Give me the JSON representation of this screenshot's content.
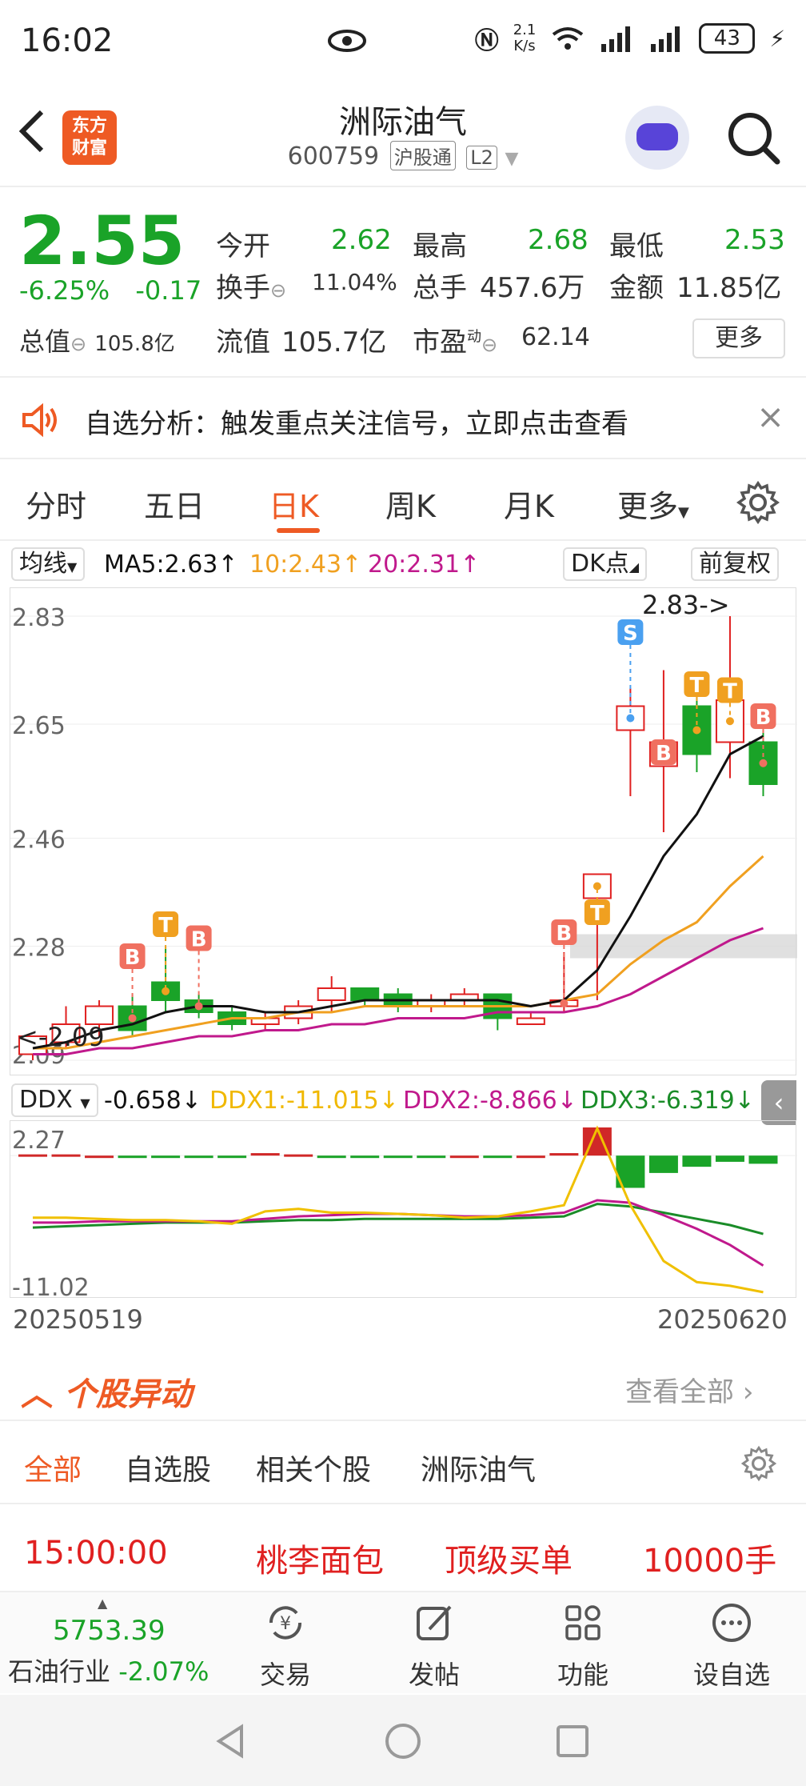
{
  "status_bar": {
    "time": "16:02",
    "net_speed_top": "2.1",
    "net_speed_bottom": "K/s",
    "battery": "43"
  },
  "header": {
    "back_icon": "chevron-left-icon",
    "logo_line1": "东方",
    "logo_line2": "财富",
    "stock_name": "洲际油气",
    "stock_code": "600759",
    "tag_hgt": "沪股通",
    "tag_l2": "L2"
  },
  "quote": {
    "price": "2.55",
    "change_pct": "-6.25%",
    "change_abs": "-0.17",
    "market_cap_label": "总值",
    "market_cap_value": "105.8亿",
    "open_label": "今开",
    "open_value": "2.62",
    "high_label": "最高",
    "high_value": "2.68",
    "low_label": "最低",
    "low_value": "2.53",
    "turnover_label": "换手",
    "turnover_value": "11.04%",
    "volume_label": "总手",
    "volume_value": "457.6万",
    "amount_label": "金额",
    "amount_value": "11.85亿",
    "float_label": "流值",
    "float_value": "105.7亿",
    "pe_label": "市盈",
    "pe_sup": "动",
    "pe_value": "62.14",
    "more_label": "更多"
  },
  "notice": {
    "text": "自选分析：触发重点关注信号，立即点击查看",
    "close": "×"
  },
  "tabs": [
    "分时",
    "五日",
    "日K",
    "周K",
    "月K",
    "更多"
  ],
  "active_tab": "日K",
  "ma_bar": {
    "avg_label": "均线",
    "ma5": "MA5:2.63↑",
    "ma10": "10:2.43↑",
    "ma20": "20:2.31↑",
    "dk_label": "DK点",
    "fq_label": "前复权"
  },
  "colors": {
    "up": "#e02020",
    "down": "#1aa328",
    "ma5": "#111111",
    "ma10": "#f0a020",
    "ma20": "#c0198c",
    "accent": "#ee5a24"
  },
  "chart_data": [
    {
      "type": "candlestick",
      "y_ticks": [
        "2.83",
        "2.65",
        "2.46",
        "2.28",
        "2.09"
      ],
      "ylim": [
        2.09,
        2.85
      ],
      "annotations": {
        "high_label": "2.83->",
        "low_label": "<-2.09"
      },
      "candles": [
        {
          "o": 2.1,
          "c": 2.13,
          "h": 2.13,
          "l": 2.09
        },
        {
          "o": 2.12,
          "c": 2.15,
          "h": 2.18,
          "l": 2.11
        },
        {
          "o": 2.15,
          "c": 2.18,
          "h": 2.19,
          "l": 2.13
        },
        {
          "o": 2.18,
          "c": 2.14,
          "h": 2.2,
          "l": 2.13
        },
        {
          "o": 2.22,
          "c": 2.19,
          "h": 2.28,
          "l": 2.17
        },
        {
          "o": 2.19,
          "c": 2.17,
          "h": 2.2,
          "l": 2.16
        },
        {
          "o": 2.17,
          "c": 2.15,
          "h": 2.18,
          "l": 2.14
        },
        {
          "o": 2.15,
          "c": 2.16,
          "h": 2.17,
          "l": 2.14
        },
        {
          "o": 2.16,
          "c": 2.18,
          "h": 2.19,
          "l": 2.15
        },
        {
          "o": 2.19,
          "c": 2.21,
          "h": 2.23,
          "l": 2.17
        },
        {
          "o": 2.21,
          "c": 2.19,
          "h": 2.21,
          "l": 2.18
        },
        {
          "o": 2.2,
          "c": 2.18,
          "h": 2.21,
          "l": 2.17
        },
        {
          "o": 2.18,
          "c": 2.19,
          "h": 2.2,
          "l": 2.17
        },
        {
          "o": 2.19,
          "c": 2.2,
          "h": 2.21,
          "l": 2.18
        },
        {
          "o": 2.2,
          "c": 2.16,
          "h": 2.2,
          "l": 2.14
        },
        {
          "o": 2.15,
          "c": 2.16,
          "h": 2.17,
          "l": 2.15
        },
        {
          "o": 2.18,
          "c": 2.19,
          "h": 2.27,
          "l": 2.17
        },
        {
          "o": 2.36,
          "c": 2.4,
          "h": 2.4,
          "l": 2.19
        },
        {
          "o": 2.64,
          "c": 2.68,
          "h": 2.71,
          "l": 2.53
        },
        {
          "o": 2.58,
          "c": 2.62,
          "h": 2.74,
          "l": 2.47
        },
        {
          "o": 2.68,
          "c": 2.6,
          "h": 2.7,
          "l": 2.57
        },
        {
          "o": 2.62,
          "c": 2.69,
          "h": 2.83,
          "l": 2.56
        },
        {
          "o": 2.62,
          "c": 2.55,
          "h": 2.64,
          "l": 2.53
        }
      ],
      "ma5": [
        2.11,
        2.12,
        2.14,
        2.15,
        2.17,
        2.18,
        2.18,
        2.17,
        2.17,
        2.18,
        2.19,
        2.19,
        2.19,
        2.19,
        2.19,
        2.18,
        2.19,
        2.24,
        2.33,
        2.43,
        2.5,
        2.6,
        2.63
      ],
      "ma10": [
        2.11,
        2.11,
        2.12,
        2.13,
        2.14,
        2.15,
        2.16,
        2.16,
        2.17,
        2.17,
        2.18,
        2.18,
        2.18,
        2.18,
        2.18,
        2.18,
        2.19,
        2.2,
        2.25,
        2.29,
        2.32,
        2.38,
        2.43
      ],
      "ma20": [
        2.1,
        2.1,
        2.11,
        2.11,
        2.12,
        2.13,
        2.13,
        2.14,
        2.14,
        2.15,
        2.15,
        2.16,
        2.16,
        2.16,
        2.17,
        2.17,
        2.17,
        2.18,
        2.2,
        2.23,
        2.26,
        2.29,
        2.31
      ],
      "signals": [
        {
          "i": 4,
          "tag": "T",
          "kind": "T"
        },
        {
          "i": 3,
          "tag": "B",
          "kind": "B"
        },
        {
          "i": 5,
          "tag": "B",
          "kind": "B"
        },
        {
          "i": 16,
          "tag": "B",
          "kind": "B"
        },
        {
          "i": 17,
          "tag": "T",
          "kind": "T"
        },
        {
          "i": 18,
          "tag": "S",
          "kind": "S"
        },
        {
          "i": 19,
          "tag": "B",
          "kind": "B"
        },
        {
          "i": 20,
          "tag": "T",
          "kind": "T"
        },
        {
          "i": 21,
          "tag": "T",
          "kind": "T"
        },
        {
          "i": 22,
          "tag": "B",
          "kind": "B"
        }
      ]
    },
    {
      "type": "bar",
      "name": "DDX",
      "y_ticks": [
        "2.27",
        "-11.02"
      ],
      "ylim": [
        -11.02,
        2.27
      ],
      "ddx": [
        0.1,
        0.1,
        0.0,
        -0.1,
        -0.1,
        -0.1,
        -0.1,
        0.2,
        0.1,
        -0.1,
        -0.1,
        -0.1,
        -0.1,
        0.0,
        -0.1,
        0.0,
        0.2,
        2.27,
        -2.6,
        -1.4,
        -0.9,
        -0.5,
        -0.658
      ],
      "ddx1": [
        -5.0,
        -5.0,
        -5.1,
        -5.2,
        -5.2,
        -5.3,
        -5.5,
        -4.5,
        -4.3,
        -4.6,
        -4.6,
        -4.7,
        -4.8,
        -5.0,
        -4.9,
        -4.5,
        -4.0,
        2.2,
        -4.0,
        -8.5,
        -10.2,
        -10.5,
        -11.015
      ],
      "ddx2": [
        -5.4,
        -5.4,
        -5.3,
        -5.3,
        -5.3,
        -5.3,
        -5.3,
        -5.1,
        -4.9,
        -4.8,
        -4.7,
        -4.7,
        -4.8,
        -4.9,
        -4.9,
        -4.8,
        -4.6,
        -3.6,
        -3.8,
        -4.8,
        -5.9,
        -7.2,
        -8.866
      ],
      "ddx3": [
        -5.8,
        -5.7,
        -5.6,
        -5.5,
        -5.4,
        -5.4,
        -5.4,
        -5.3,
        -5.2,
        -5.2,
        -5.1,
        -5.1,
        -5.1,
        -5.1,
        -5.1,
        -5.0,
        -4.9,
        -3.9,
        -4.1,
        -4.6,
        -5.1,
        -5.6,
        -6.319
      ]
    }
  ],
  "ddx_bar": {
    "label": "DDX",
    "ddx_val": "-0.658↓",
    "ddx1_val": "DDX1:-11.015↓",
    "ddx2_val": "DDX2:-8.866↓",
    "ddx3_val": "DDX3:-6.319↓"
  },
  "dates": {
    "start": "20250519",
    "end": "20250620"
  },
  "movers": {
    "title": "个股异动",
    "view_all": "查看全部",
    "filters": [
      "全部",
      "自选股",
      "相关个股",
      "洲际油气"
    ],
    "alert_time": "15:00:00",
    "alert_source": "桃李面包",
    "alert_type": "顶级买单",
    "alert_amount": "10000手"
  },
  "bottom": {
    "index_value": "5753.39",
    "index_name": "石油行业",
    "index_change": "-2.07%",
    "buttons": [
      {
        "label": "交易",
        "icon": "trade-icon"
      },
      {
        "label": "发帖",
        "icon": "edit-icon"
      },
      {
        "label": "功能",
        "icon": "apps-icon"
      },
      {
        "label": "设自选",
        "icon": "more-circle-icon"
      }
    ]
  }
}
